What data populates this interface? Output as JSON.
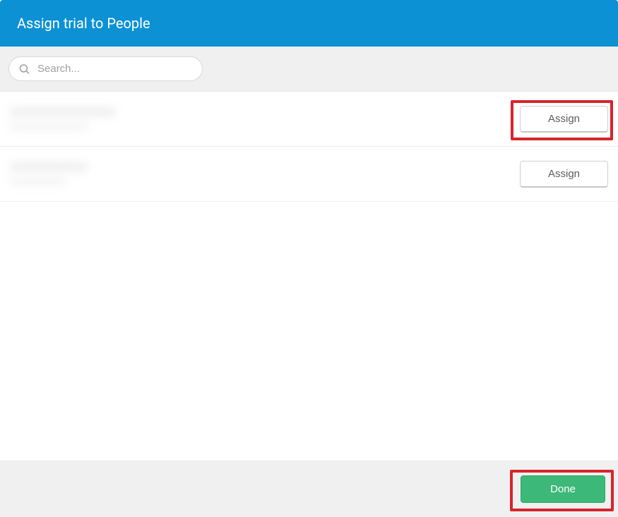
{
  "header": {
    "title": "Assign trial to People"
  },
  "search": {
    "placeholder": "Search..."
  },
  "rows": [
    {
      "assign_label": "Assign"
    },
    {
      "assign_label": "Assign"
    }
  ],
  "footer": {
    "done_label": "Done"
  }
}
